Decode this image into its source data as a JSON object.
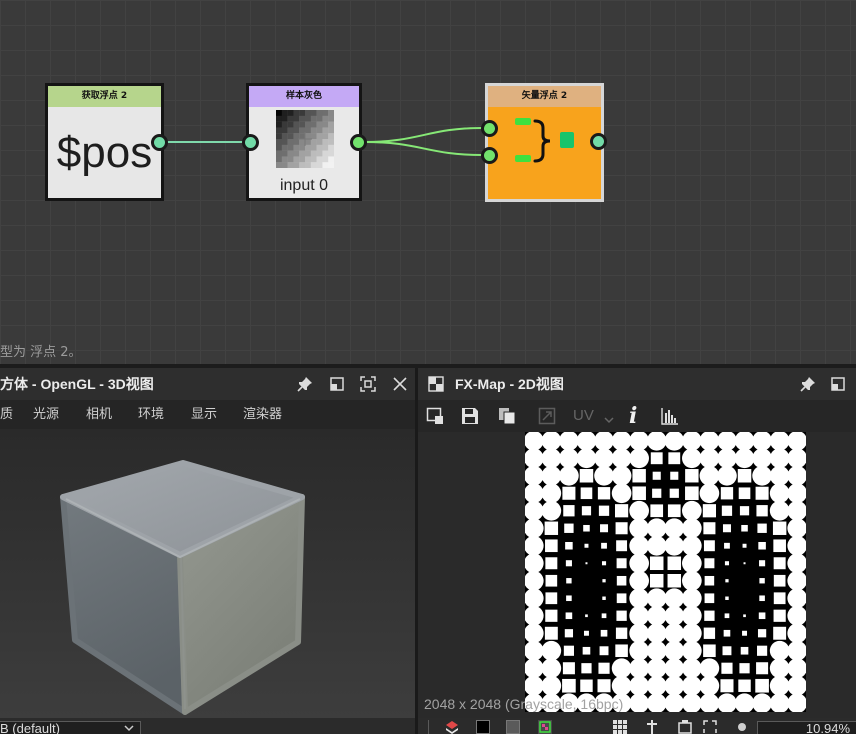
{
  "graph": {
    "node_get_float2": {
      "title": "获取浮点 2",
      "value": "$pos",
      "header_color": "#b6d58c"
    },
    "node_sample_gray": {
      "title": "样本灰色",
      "input_label": "input 0",
      "header_color": "#c4a9f5"
    },
    "node_vector_float2": {
      "title": "矢量浮点 2",
      "header_color": "#dfb180",
      "body_color": "#f8a31c"
    },
    "status_text": "型为 浮点 2。"
  },
  "view3d": {
    "title": "方体 - OpenGL - 3D视图",
    "menu": [
      "质",
      "光源",
      "相机",
      "环境",
      "显示",
      "渲染器"
    ],
    "color_space": "B (default)",
    "titlebar_icons": [
      "pin-icon",
      "restore-icon",
      "maximize-icon",
      "close-icon"
    ]
  },
  "view2d": {
    "title": "FX-Map - 2D视图",
    "toolbar": {
      "uv_label": "UV",
      "info_label": "i"
    },
    "image_info": "2048 x 2048 (Grayscale, 16bpc)",
    "zoom": "10.94%",
    "titlebar_icons": [
      "view-2d-icon",
      "pin-icon",
      "restore-icon"
    ],
    "toolbar_icons": [
      "export-view-icon",
      "save-icon",
      "copy-icon",
      "tile-icon",
      "chevron-down-icon",
      "info-icon",
      "histogram-icon"
    ],
    "bottom_icons": [
      "layers-icon",
      "black-background-icon",
      "gray-background-icon",
      "checker-background-icon",
      "grid-icon",
      "pin-icon",
      "fit-frame-icon",
      "frame-icon",
      "zoom-slider-handle"
    ]
  },
  "colors": {
    "wire_float": "#7fd9ab",
    "wire_float2": "#86e876",
    "port_float": "#72dba7",
    "port_float2": "#72e26c",
    "selected_border": "#d6d6d6"
  }
}
